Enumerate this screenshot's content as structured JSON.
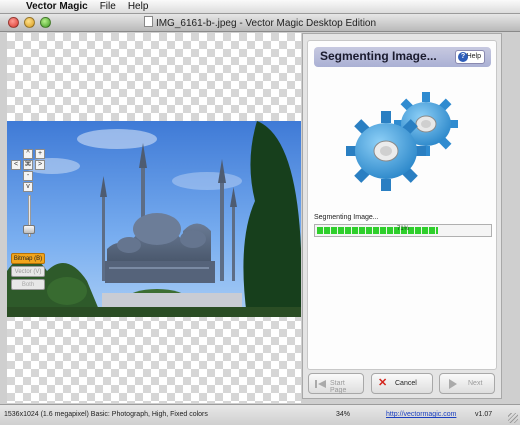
{
  "menubar": {
    "app_name": "Vector Magic",
    "menus": [
      "File",
      "Help"
    ]
  },
  "window": {
    "title": "IMG_6161-b-.jpeg - Vector Magic Desktop Edition"
  },
  "canvas_controls": {
    "pan_up": "^",
    "pan_down": "v",
    "pan_left": "<",
    "pan_right": ">",
    "zoom_in": "+",
    "zoom_out": "-",
    "fit": "⌘",
    "modes": {
      "bitmap": "Bitmap (B)",
      "vector": "Vector (V)",
      "both": "Both"
    }
  },
  "panel": {
    "title": "Segmenting Image...",
    "help_label": "Help",
    "progress_label": "Segmenting Image...",
    "progress_percent": 71,
    "progress_text": "71%"
  },
  "footer": {
    "start_page": "Start Page",
    "cancel": "Cancel",
    "next": "Next"
  },
  "status": {
    "image_info": "1536x1024 (1.6 megapixel)  Basic: Photograph, High, Fixed colors",
    "zoom": "34%",
    "link": "http://vectormagic.com",
    "version": "v1.07"
  },
  "colors": {
    "accent_orange": "#f2a51c",
    "progress_green": "#2fcf2c",
    "header_blue": "#aab0d4",
    "gear_blue": "#3f9fdc"
  }
}
